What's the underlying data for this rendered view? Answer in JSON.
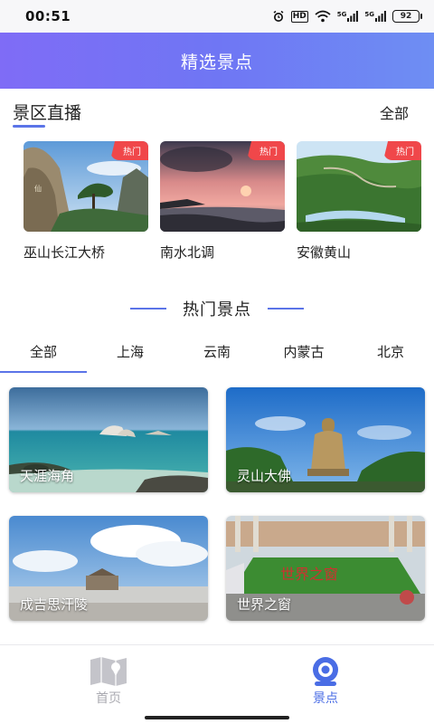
{
  "status_bar": {
    "time": "00:51",
    "icons": [
      "alarm-icon",
      "hd-icon",
      "wifi-icon",
      "signal-icon",
      "signal-icon",
      "battery-icon"
    ],
    "hd_label": "HD",
    "signal_label": "5G",
    "battery": "92"
  },
  "header": {
    "title": "精选景点"
  },
  "live": {
    "title": "景区直播",
    "all_label": "全部",
    "hot_tag": "热门",
    "items": [
      {
        "name": "巫山长江大桥"
      },
      {
        "name": "南水北调"
      },
      {
        "name": "安徽黄山"
      }
    ]
  },
  "hot": {
    "title": "热门景点",
    "tabs": [
      "全部",
      "上海",
      "云南",
      "内蒙古",
      "北京"
    ],
    "active_tab": 0,
    "items": [
      {
        "name": "天涯海角"
      },
      {
        "name": "灵山大佛"
      },
      {
        "name": "成吉思汗陵"
      },
      {
        "name": "世界之窗"
      }
    ]
  },
  "nav": {
    "items": [
      {
        "label": "首页",
        "icon": "map-icon",
        "color": "#a9a9b0"
      },
      {
        "label": "景点",
        "icon": "camera-icon",
        "color": "#4a6de5"
      }
    ]
  },
  "colors": {
    "accent": "#5b74e8",
    "hot_tag": "#f0474a",
    "header_start": "#7f6cf6",
    "header_end": "#6e8ef3"
  }
}
